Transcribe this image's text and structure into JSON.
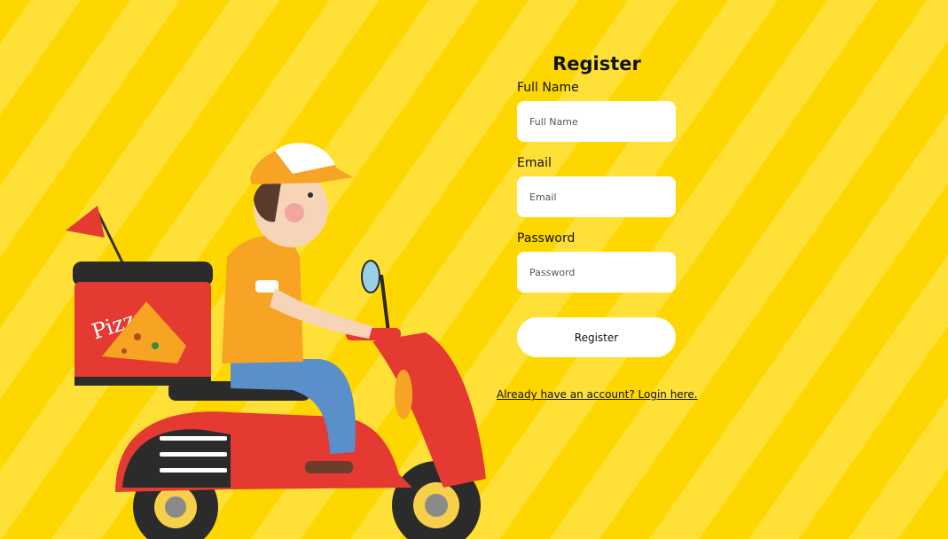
{
  "form": {
    "title": "Register",
    "full_name": {
      "label": "Full Name",
      "placeholder": "Full Name"
    },
    "email": {
      "label": "Email",
      "placeholder": "Email"
    },
    "password": {
      "label": "Password",
      "placeholder": "Password"
    },
    "submit_label": "Register",
    "login_link": "Already have an account? Login here."
  },
  "illustration": {
    "box_text": "Pizza"
  },
  "colors": {
    "background": "#ffd700",
    "stripe": "#ffe037",
    "input_bg": "#ffffff",
    "scooter": "#e43a32",
    "shirt": "#f7a323"
  }
}
